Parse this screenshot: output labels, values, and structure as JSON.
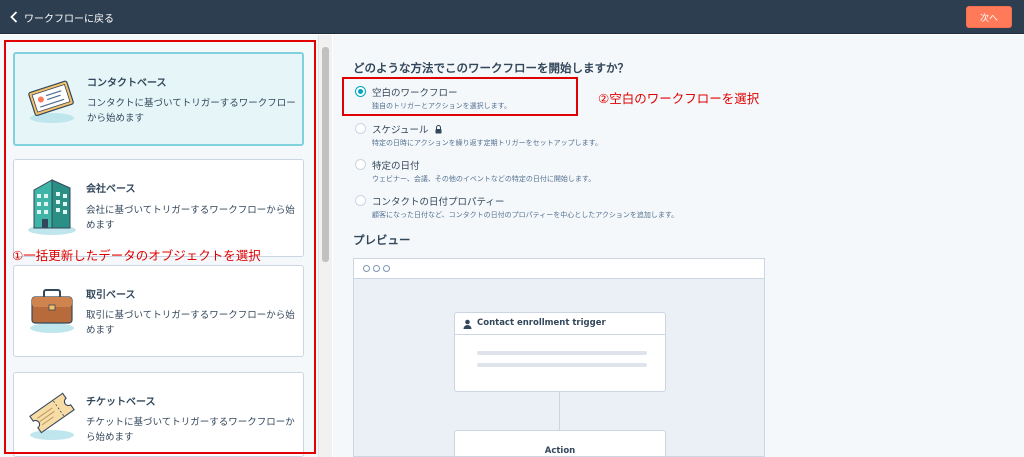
{
  "topbar": {
    "back_label": "ワークフローに戻る",
    "next_label": "次へ"
  },
  "cards": [
    {
      "title": "コンタクトベース",
      "desc": "コンタクトに基づいてトリガーするワークフローから始めます",
      "icon": "contact-card-icon",
      "selected": true
    },
    {
      "title": "会社ベース",
      "desc": "会社に基づいてトリガーするワークフローから始めます",
      "icon": "building-icon",
      "selected": false
    },
    {
      "title": "取引ベース",
      "desc": "取引に基づいてトリガーするワークフローから始めます",
      "icon": "briefcase-icon",
      "selected": false
    },
    {
      "title": "チケットベース",
      "desc": "チケットに基づいてトリガーするワークフローから始めます",
      "icon": "ticket-icon",
      "selected": false
    }
  ],
  "annotations": {
    "left": "①一括更新したデータのオブジェクトを選択",
    "right": "②空白のワークフローを選択"
  },
  "main": {
    "question": "どのような方法でこのワークフローを開始しますか？",
    "options": [
      {
        "label": "空白のワークフロー",
        "sub": "独自のトリガーとアクションを選択します。",
        "selected": true
      },
      {
        "label": "スケジュール",
        "sub": "特定の日時にアクションを繰り返す定期トリガーをセットアップします。",
        "selected": false,
        "locked": true
      },
      {
        "label": "特定の日付",
        "sub": "ウェビナー、会議、その他のイベントなどの特定の日付に開始します。",
        "selected": false
      },
      {
        "label": "コンタクトの日付プロパティー",
        "sub": "顧客になった日付など、コンタクトの日付のプロパティーを中心としたアクションを追加します。",
        "selected": false
      }
    ],
    "preview_title": "プレビュー",
    "preview": {
      "trigger_label": "Contact enrollment trigger",
      "action_label": "Action"
    }
  },
  "colors": {
    "topbar": "#2d3e50",
    "accent": "#ff7a59",
    "teal": "#00a4bd",
    "annotation": "#e00000"
  }
}
